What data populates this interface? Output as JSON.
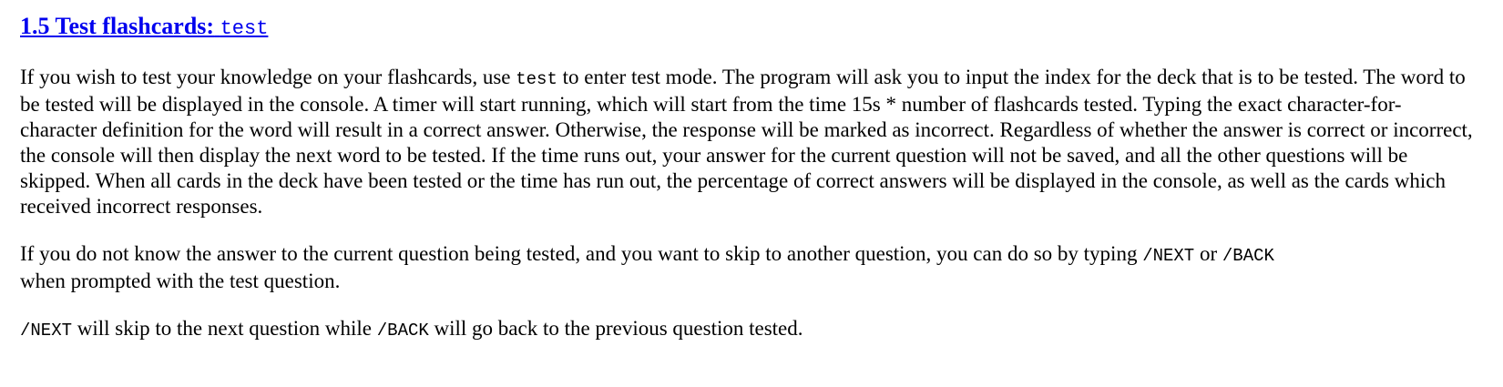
{
  "section": {
    "number": "1.5",
    "title": "Test flashcards:",
    "command": "test"
  },
  "paragraph1": {
    "text_before": "If you wish to test your knowledge on your flashcards, use ",
    "code": "test",
    "text_after": " to enter test mode. The program will ask you to input the index for the deck that is to be tested. The word to be tested will be displayed in the console. A timer will start running, which will start from the time 15s * number of flashcards tested. Typing the exact character-for-character definition for the word will result in a correct answer. Otherwise, the response will be marked as incorrect. Regardless of whether the answer is correct or incorrect, the console will then display the next word to be tested. If the time runs out, your answer for the current question will not be saved, and all the other questions will be skipped. When all cards in the deck have been tested or the time has run out, the percentage of correct answers will be displayed in the console, as well as the cards which received incorrect responses."
  },
  "paragraph2": {
    "text_before": "If you do not know the answer to the current question being tested, and you want to skip to another question, you can do so by typing ",
    "code_next": "/NEXT",
    "text_mid": " or ",
    "code_back": "/BACK",
    "text_after": " when prompted with the test question."
  },
  "paragraph3": {
    "code_next": "/NEXT",
    "text_mid": " will skip to the next question while ",
    "code_back": "/BACK",
    "text_after": " will go back to the previous question tested."
  }
}
